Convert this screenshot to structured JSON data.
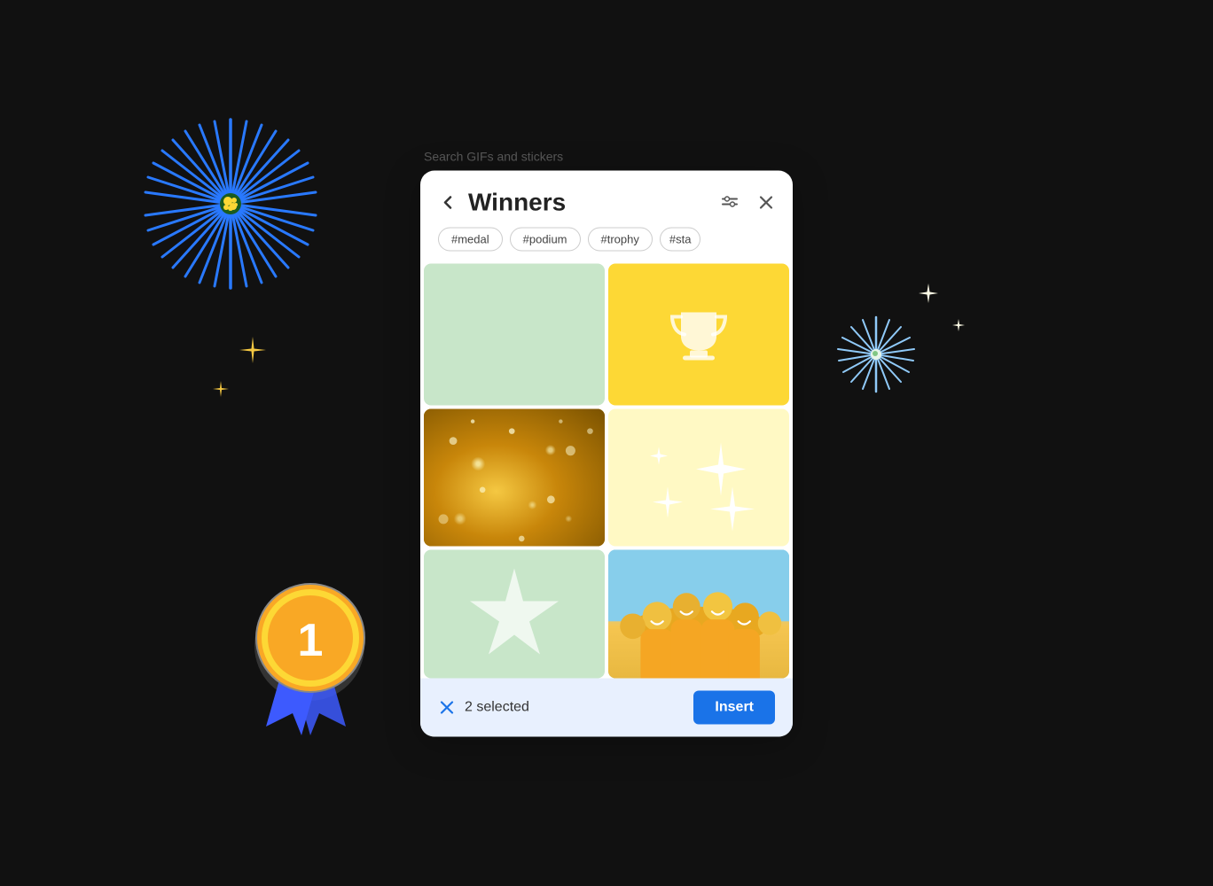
{
  "page": {
    "background": "#111"
  },
  "search_label": "Search GIFs and stickers",
  "header": {
    "title": "Winners",
    "back_label": "←",
    "close_label": "✕",
    "filter_label": "⊟"
  },
  "tags": [
    {
      "id": "tag-medal",
      "label": "#medal"
    },
    {
      "id": "tag-podium",
      "label": "#podium"
    },
    {
      "id": "tag-trophy",
      "label": "#trophy"
    },
    {
      "id": "tag-star",
      "label": "#sta"
    }
  ],
  "grid": {
    "cells": [
      {
        "id": "cell-1",
        "type": "mint",
        "description": "Mint green blank"
      },
      {
        "id": "cell-2",
        "type": "yellow-trophy",
        "description": "Yellow trophy icon"
      },
      {
        "id": "cell-3",
        "type": "gold-sparkle",
        "description": "Gold glitter shimmer"
      },
      {
        "id": "cell-4",
        "type": "cream-sparkles",
        "description": "Cream with sparkle stars"
      },
      {
        "id": "cell-5",
        "type": "mint-star",
        "description": "Mint with star"
      },
      {
        "id": "cell-6",
        "type": "team-photo",
        "description": "Team celebrating"
      }
    ]
  },
  "bottom_bar": {
    "selected_count": "2 selected",
    "insert_label": "Insert",
    "clear_label": "✕"
  },
  "decorations": {
    "starburst_blue": "blue starburst top left",
    "starburst_light": "light blue starburst right",
    "medal": "gold number 1 medal with blue ribbon",
    "sparkles": "yellow sparkle stars"
  }
}
